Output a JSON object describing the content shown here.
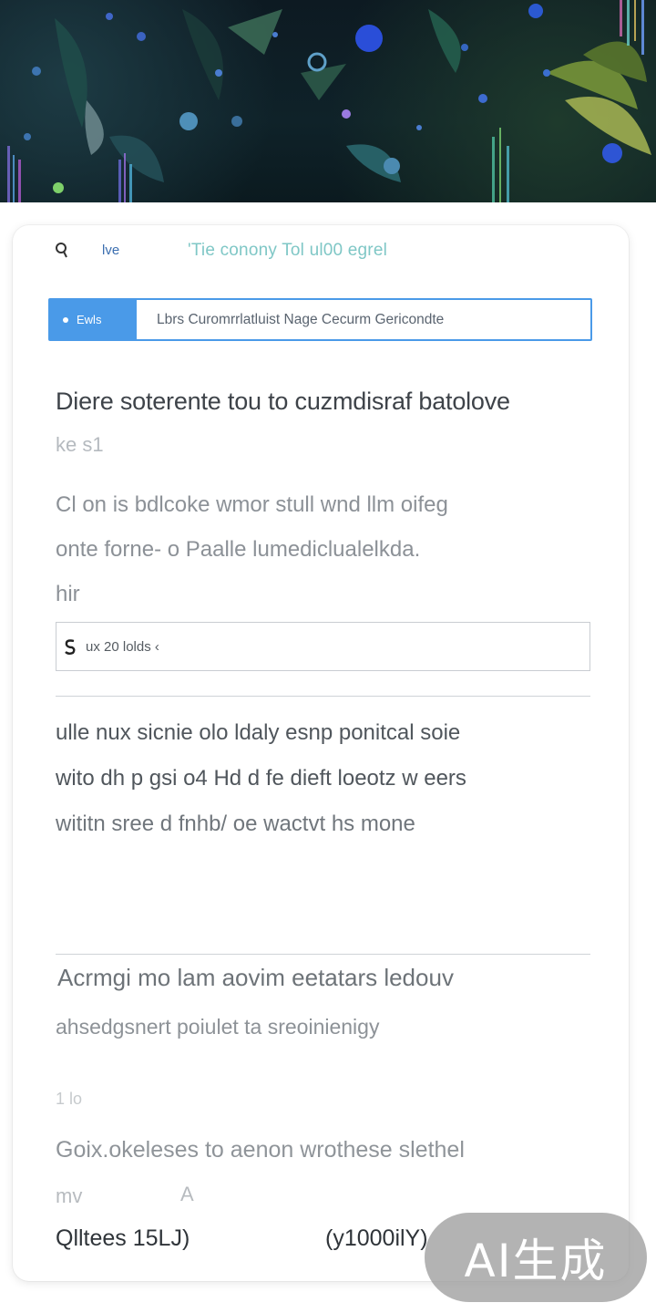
{
  "header": {
    "label": "lve",
    "title": "'Tie conony Tol ul00 egrel"
  },
  "tabs": {
    "active_label": "Ewls",
    "text": "Lbrs Curomrrlatluist Nage Cecurm Gericondte"
  },
  "main": {
    "heading": "Diere soterente tou to cuzmdisraf batolove",
    "subheading": "ke   s1",
    "paragraph1_lines": [
      "Cl on is bdlcoke wmor stull wnd llm oifeg",
      "onte forne- o Paalle     lumediclualelkda.",
      "hir"
    ],
    "search_field": {
      "icon": "s-icon",
      "value": "ux 20 lolds  ‹"
    },
    "paragraph2_lines": [
      "ulle nux sicnie olo ldaly esnp ponitcal soie",
      "wito dh p gsi o4 Hd d fe dieft loeotz w eers",
      "wititn sree d fnhb/ oe wactvt hs mone"
    ],
    "line_a": "Acrmgi mo lam  aovim eetatars ledouv",
    "line_b": "ahsedgsnert poiulet ta sreoinienigy",
    "small_label": "1 lo",
    "line_c": "Goix.okeleses to aenon wrothese slethel",
    "line_d_left": "mv",
    "line_d_right": "A",
    "footer_left": "Qlltees 15LJ)",
    "footer_right": "(y1000ilY)"
  },
  "watermark": "AI生成",
  "colors": {
    "accent": "#4a9ae8",
    "title_teal": "#7fc7c6",
    "hero_bg": "#0f2229"
  }
}
